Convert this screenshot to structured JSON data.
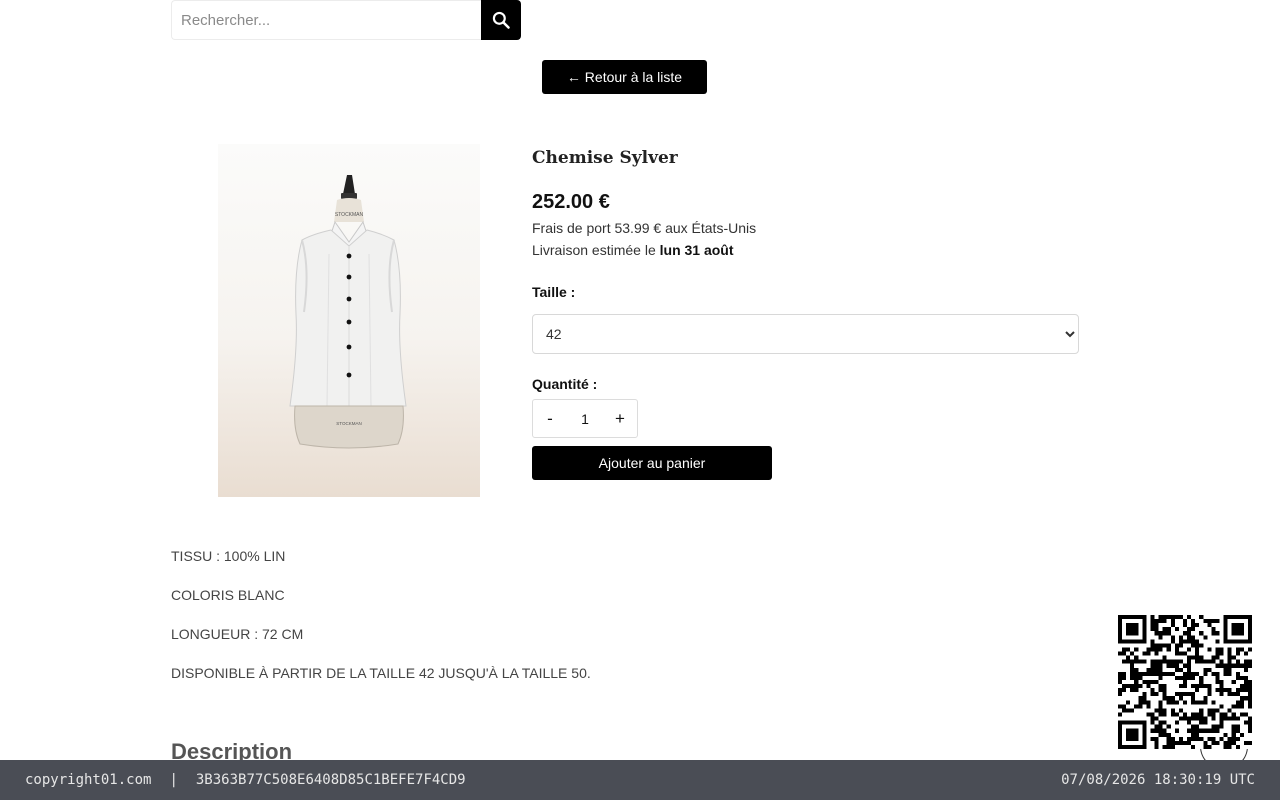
{
  "search": {
    "placeholder": "Rechercher..."
  },
  "nav": {
    "back_label": "← Retour à la liste"
  },
  "product": {
    "title": "Chemise Sylver",
    "price": "252.00 €",
    "shipping": "Frais de port 53.99 € aux États-Unis",
    "delivery_prefix": "Livraison estimée le",
    "delivery_date": "lun 31 août",
    "size_label": "Taille :",
    "size_selected": "42",
    "quantity_label": "Quantité :",
    "quantity_minus": "-",
    "quantity_value": "1",
    "quantity_plus": "+",
    "add_to_cart_label": "Ajouter au panier",
    "mannequin_label": "STOCKMAN"
  },
  "description": {
    "lines": [
      "TISSU : 100% LIN",
      "COLORIS BLANC",
      "LONGUEUR : 72 CM",
      "DISPONIBLE À PARTIR DE LA TAILLE 42 JUSQU'À LA TAILLE 50."
    ],
    "heading": "Description"
  },
  "footer": {
    "site": "copyright01.com",
    "separator": "|",
    "hash": "3B363B77C508E6408D85C1BEFE7F4CD9",
    "timestamp": "07/08/2026 18:30:19 UTC"
  },
  "icons": {
    "search": "search-icon",
    "qr": "qr-code",
    "scroll": "scroll-top-icon"
  },
  "colors": {
    "accent": "#000000",
    "footer_bg": "#4a4d55",
    "footer_text": "#e6e6e6"
  }
}
